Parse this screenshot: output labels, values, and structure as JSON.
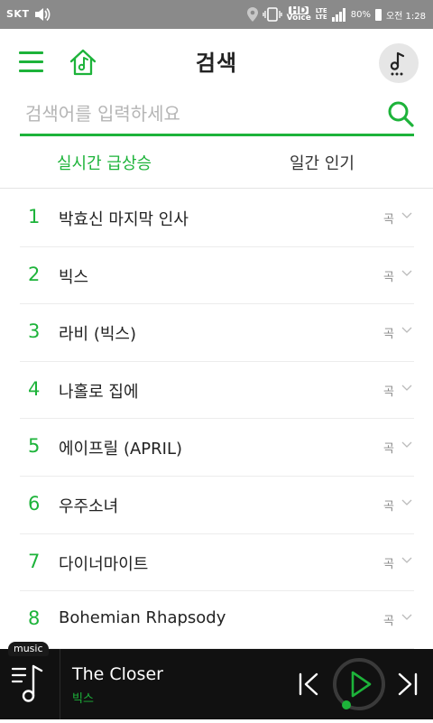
{
  "statusbar": {
    "carrier": "SKT",
    "hd_top": "HD",
    "hd_bottom": "Voice",
    "lte_top": "LTE",
    "lte_bottom": "LTE",
    "battery": "80%",
    "time": "오전 1:28"
  },
  "header": {
    "title": "검색"
  },
  "search": {
    "placeholder": "검색어를 입력하세요",
    "value": ""
  },
  "tabs": [
    {
      "label": "실시간 급상승",
      "active": true
    },
    {
      "label": "일간 인기",
      "active": false
    }
  ],
  "ranking": [
    {
      "rank": "1",
      "name": "박효신 마지막 인사",
      "type": "곡"
    },
    {
      "rank": "2",
      "name": "빅스",
      "type": "곡"
    },
    {
      "rank": "3",
      "name": "라비 (빅스)",
      "type": "곡"
    },
    {
      "rank": "4",
      "name": "나홀로 집에",
      "type": "곡"
    },
    {
      "rank": "5",
      "name": "에이프릴 (APRIL)",
      "type": "곡"
    },
    {
      "rank": "6",
      "name": "우주소녀",
      "type": "곡"
    },
    {
      "rank": "7",
      "name": "다이너마이트",
      "type": "곡"
    },
    {
      "rank": "8",
      "name": "Bohemian Rhapsody",
      "type": "곡"
    }
  ],
  "player": {
    "tag": "music",
    "track": "The Closer",
    "artist": "빅스",
    "progress": 0
  },
  "colors": {
    "accent": "#1db33a",
    "statusbar": "#8a8a8a",
    "player_bg": "#111111"
  }
}
